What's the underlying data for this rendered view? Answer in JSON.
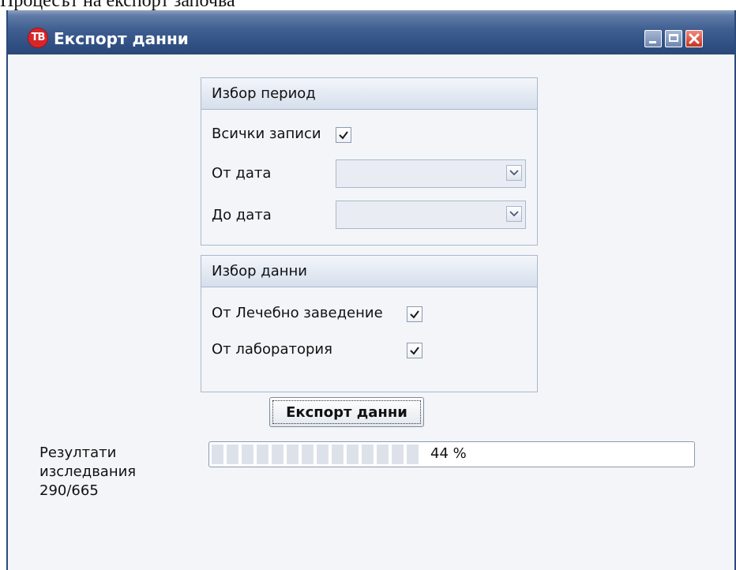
{
  "document_caption": "Процесът на експорт започва",
  "window": {
    "title": "Експорт данни",
    "icon_text": "TB",
    "icon": "app-logo-icon"
  },
  "period_group": {
    "header": "Избор период",
    "all_records_label": "Всички записи",
    "all_records_checked": true,
    "from_date_label": "От дата",
    "from_date_value": "",
    "to_date_label": "До дата",
    "to_date_value": ""
  },
  "data_group": {
    "header": "Избор данни",
    "hospital_label": "От Лечебно заведение",
    "hospital_checked": true,
    "laboratory_label": "От лаборатория",
    "laboratory_checked": true
  },
  "export_button_label": "Експорт данни",
  "results": {
    "line1": "Резултати",
    "line2": "изследвания",
    "count": "290/665"
  },
  "progress": {
    "value": 0.44,
    "text": "44 %"
  },
  "colors": {
    "titlebar": "#3e5e90",
    "window_bg": "#f3f5f8",
    "close_button": "#c8311f",
    "app_icon": "#d7262a"
  }
}
